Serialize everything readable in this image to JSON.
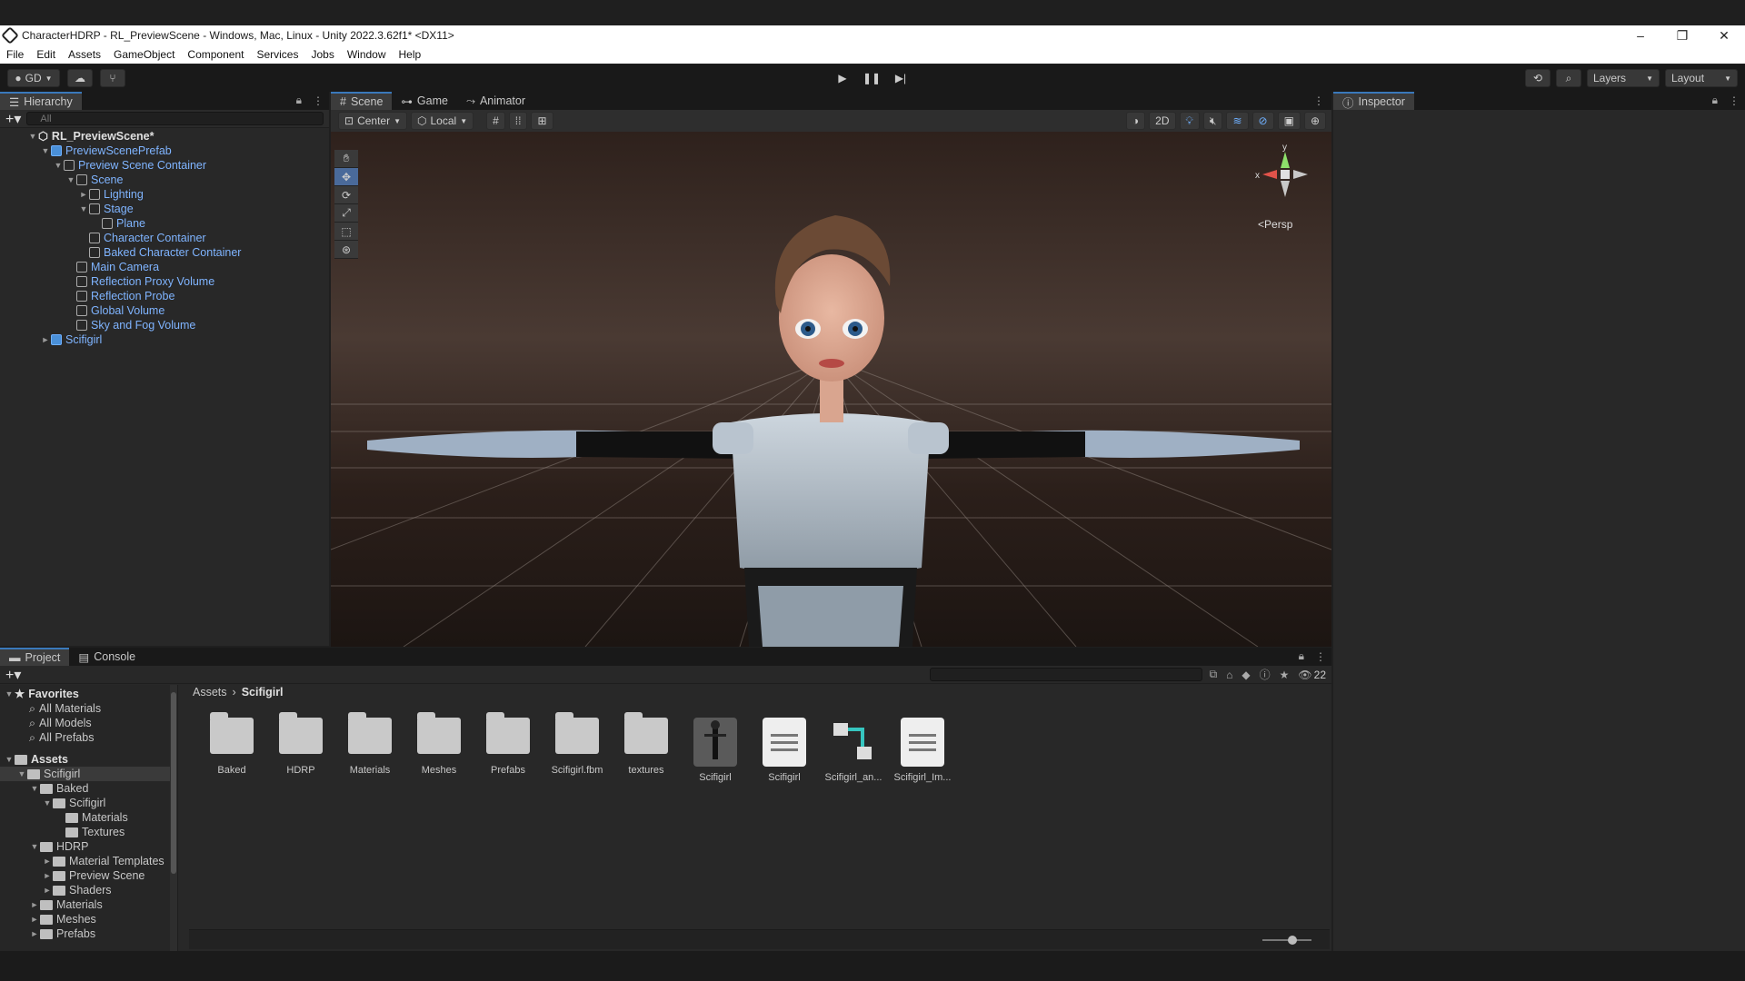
{
  "window": {
    "title": "CharacterHDRP - RL_PreviewScene - Windows, Mac, Linux - Unity 2022.3.62f1* <DX11>",
    "controls": [
      "–",
      "❐",
      "✕"
    ]
  },
  "menu": [
    "File",
    "Edit",
    "Assets",
    "GameObject",
    "Component",
    "Services",
    "Jobs",
    "Window",
    "Help"
  ],
  "toolbar": {
    "account": "GD",
    "layers": "Layers",
    "layout": "Layout"
  },
  "hierarchy": {
    "tab": "Hierarchy",
    "search_placeholder": "All",
    "scene": "RL_PreviewScene*",
    "items": [
      {
        "label": "PreviewScenePrefab",
        "depth": 1,
        "arrow": "▼",
        "blue": true
      },
      {
        "label": "Preview Scene Container",
        "depth": 2,
        "arrow": "▼"
      },
      {
        "label": "Scene",
        "depth": 3,
        "arrow": "▼"
      },
      {
        "label": "Lighting",
        "depth": 4,
        "arrow": "►"
      },
      {
        "label": "Stage",
        "depth": 4,
        "arrow": "▼"
      },
      {
        "label": "Plane",
        "depth": 5,
        "arrow": ""
      },
      {
        "label": "Character Container",
        "depth": 4,
        "arrow": ""
      },
      {
        "label": "Baked Character Container",
        "depth": 4,
        "arrow": ""
      },
      {
        "label": "Main Camera",
        "depth": 3,
        "arrow": ""
      },
      {
        "label": "Reflection Proxy Volume",
        "depth": 3,
        "arrow": ""
      },
      {
        "label": "Reflection Probe",
        "depth": 3,
        "arrow": ""
      },
      {
        "label": "Global Volume",
        "depth": 3,
        "arrow": ""
      },
      {
        "label": "Sky and Fog Volume",
        "depth": 3,
        "arrow": ""
      },
      {
        "label": "Scifigirl",
        "depth": 1,
        "arrow": "►",
        "blue": true
      }
    ]
  },
  "scene_tabs": [
    {
      "label": "Scene",
      "icon": "grid-icon",
      "active": true
    },
    {
      "label": "Game",
      "icon": "gamepad-icon",
      "active": false
    },
    {
      "label": "Animator",
      "icon": "animator-icon",
      "active": false
    }
  ],
  "scene_toolbar": {
    "pivot": "Center",
    "space": "Local",
    "mode_2d": "2D"
  },
  "gizmo": {
    "x": "x",
    "y": "y",
    "projection": "Persp"
  },
  "inspector": {
    "tab": "Inspector"
  },
  "project": {
    "tabs": [
      {
        "label": "Project",
        "active": true
      },
      {
        "label": "Console",
        "active": false
      }
    ],
    "hidden_count": "22",
    "breadcrumb": [
      "Assets",
      "Scifigirl"
    ],
    "favorites": {
      "label": "Favorites",
      "items": [
        "All Materials",
        "All Models",
        "All Prefabs"
      ]
    },
    "assets_root": "Assets",
    "tree": [
      {
        "label": "Scifigirl",
        "depth": 1,
        "arrow": "▼",
        "selected": true
      },
      {
        "label": "Baked",
        "depth": 2,
        "arrow": "▼"
      },
      {
        "label": "Scifigirl",
        "depth": 3,
        "arrow": "▼"
      },
      {
        "label": "Materials",
        "depth": 4,
        "arrow": ""
      },
      {
        "label": "Textures",
        "depth": 4,
        "arrow": ""
      },
      {
        "label": "HDRP",
        "depth": 2,
        "arrow": "▼"
      },
      {
        "label": "Material Templates",
        "depth": 3,
        "arrow": "►"
      },
      {
        "label": "Preview Scene",
        "depth": 3,
        "arrow": "►"
      },
      {
        "label": "Shaders",
        "depth": 3,
        "arrow": "►"
      },
      {
        "label": "Materials",
        "depth": 2,
        "arrow": "►"
      },
      {
        "label": "Meshes",
        "depth": 2,
        "arrow": "►"
      },
      {
        "label": "Prefabs",
        "depth": 2,
        "arrow": "►"
      }
    ],
    "assets": [
      {
        "label": "Baked",
        "kind": "folder"
      },
      {
        "label": "HDRP",
        "kind": "folder"
      },
      {
        "label": "Materials",
        "kind": "folder"
      },
      {
        "label": "Meshes",
        "kind": "folder"
      },
      {
        "label": "Prefabs",
        "kind": "folder"
      },
      {
        "label": "Scifigirl.fbm",
        "kind": "folder"
      },
      {
        "label": "textures",
        "kind": "folder"
      },
      {
        "label": "Scifigirl",
        "kind": "model"
      },
      {
        "label": "Scifigirl",
        "kind": "doc"
      },
      {
        "label": "Scifigirl_an...",
        "kind": "animator"
      },
      {
        "label": "Scifigirl_Im...",
        "kind": "doc"
      }
    ]
  }
}
